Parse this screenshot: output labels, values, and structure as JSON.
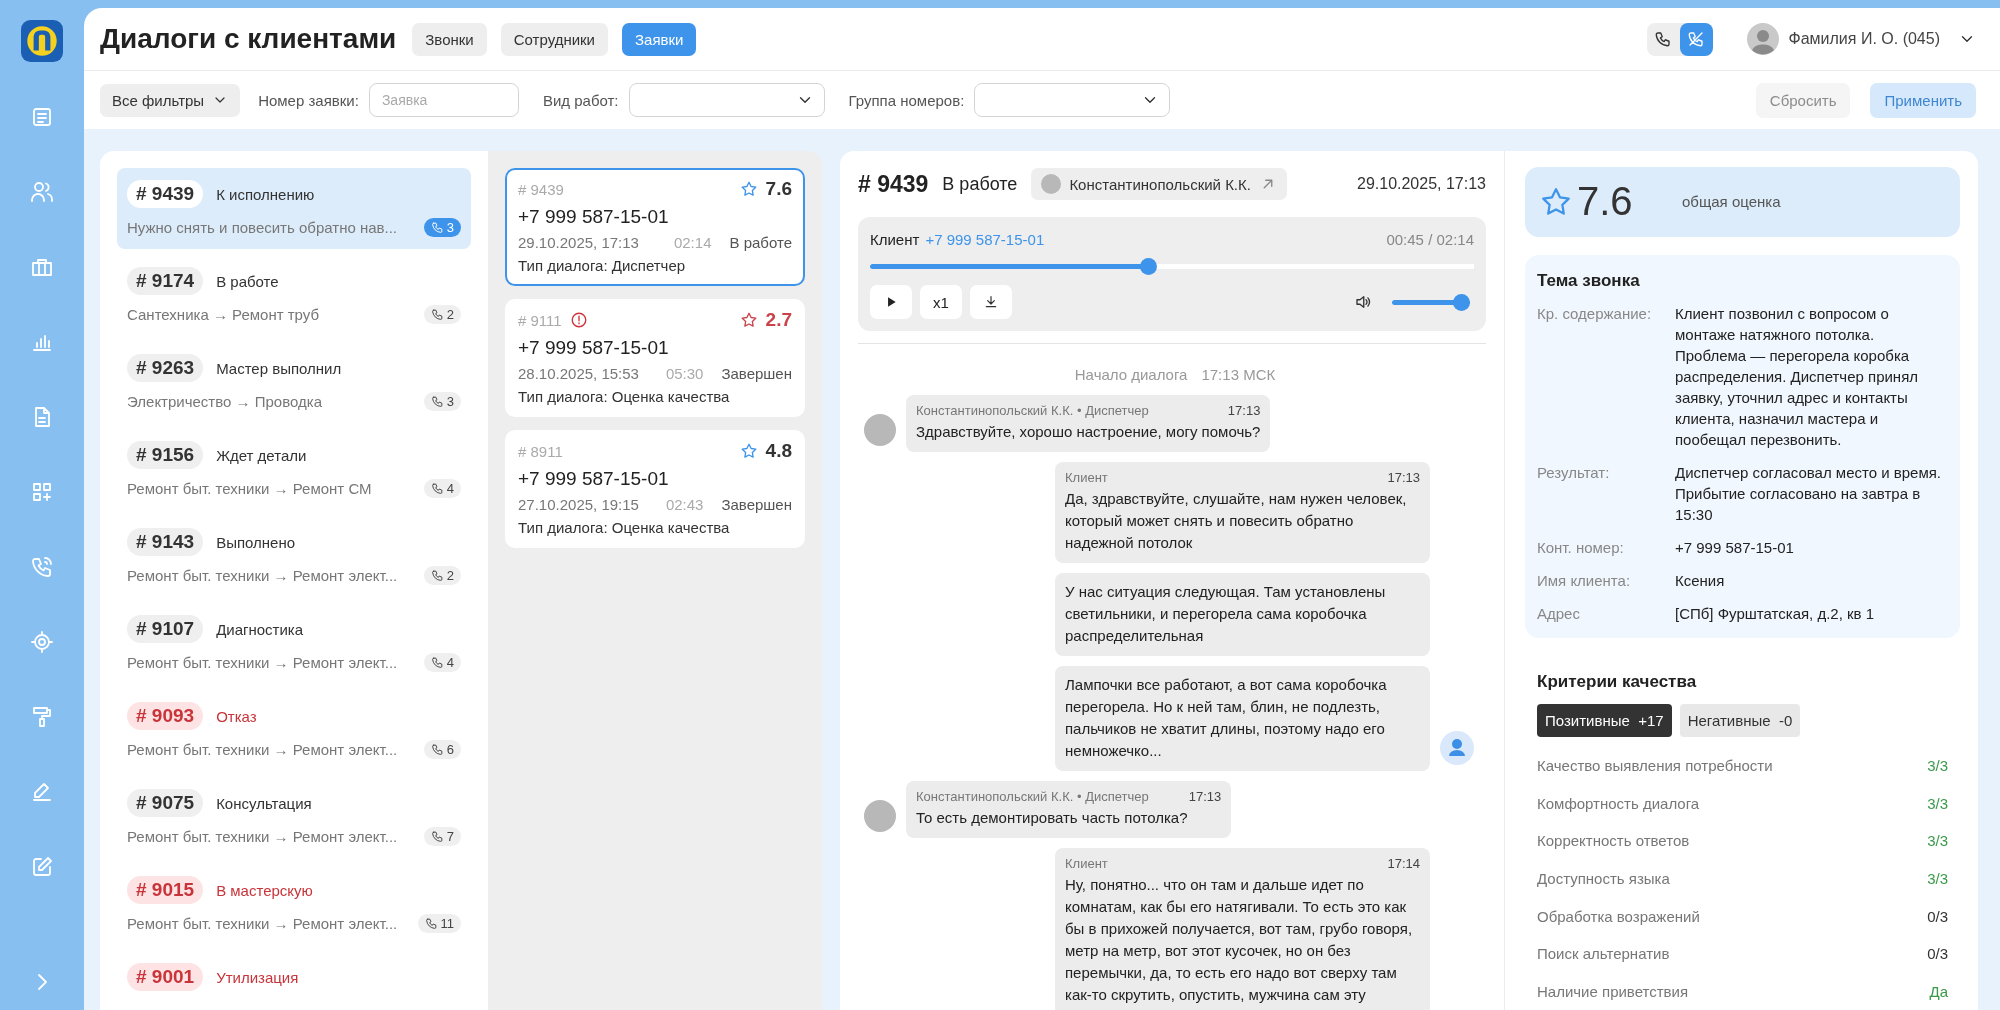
{
  "header": {
    "title": "Диалоги с клиентами",
    "tabs": [
      {
        "label": "Звонки",
        "selected": false
      },
      {
        "label": "Сотрудники",
        "selected": false
      },
      {
        "label": "Заявки",
        "selected": true
      }
    ],
    "call_modes": [
      {
        "kind": "phone",
        "selected": false
      },
      {
        "kind": "phone_off",
        "selected": true
      }
    ],
    "user": {
      "name": "Фамилия И. О. (045)"
    }
  },
  "filters": {
    "all_filters": "Все фильтры",
    "fields": [
      {
        "kind": "input",
        "label": "Номер заявки:",
        "placeholder": "Заявка"
      },
      {
        "kind": "select",
        "label": "Вид работ:"
      },
      {
        "kind": "select",
        "label": "Группа номеров:"
      }
    ],
    "buttons": [
      {
        "kind": "secondary",
        "label": "Сбросить",
        "disabled": true
      },
      {
        "kind": "primary",
        "label": "Применить",
        "disabled": true
      }
    ]
  },
  "orders": [
    {
      "number": "# 9439",
      "status": "К исполнению",
      "subtitle": "Нужно снять и повесить обратно нав...",
      "calls": "3",
      "alert": false,
      "selected": true
    },
    {
      "number": "# 9174",
      "status": "В работе",
      "subtitle": "Сантехника → Ремонт труб",
      "calls": "2",
      "alert": false,
      "selected": false
    },
    {
      "number": "# 9263",
      "status": "Мастер выполнил",
      "subtitle": "Электричество → Проводка",
      "calls": "3",
      "alert": false,
      "selected": false
    },
    {
      "number": "# 9156",
      "status": "Ждет детали",
      "subtitle": "Ремонт быт. техники → Ремонт СМ",
      "calls": "4",
      "alert": false,
      "selected": false
    },
    {
      "number": "# 9143",
      "status": "Выполнено",
      "subtitle": "Ремонт быт. техники → Ремонт элект...",
      "calls": "2",
      "alert": false,
      "selected": false
    },
    {
      "number": "# 9107",
      "status": "Диагностика",
      "subtitle": "Ремонт быт. техники → Ремонт элект...",
      "calls": "4",
      "alert": false,
      "selected": false
    },
    {
      "number": "# 9093",
      "status": "Отказ",
      "subtitle": "Ремонт быт. техники → Ремонт элект...",
      "calls": "6",
      "alert": true,
      "selected": false
    },
    {
      "number": "# 9075",
      "status": "Консультация",
      "subtitle": "Ремонт быт. техники → Ремонт элект...",
      "calls": "7",
      "alert": false,
      "selected": false
    },
    {
      "number": "# 9015",
      "status": "В мастерскую",
      "subtitle": "Ремонт быт. техники → Ремонт элект...",
      "calls": "11",
      "alert": true,
      "selected": false
    },
    {
      "number": "# 9001",
      "status": "Утилизация",
      "alert": true,
      "selected": false
    }
  ],
  "calls": [
    {
      "number": "# 9439",
      "flagged": false,
      "rating": "7.6",
      "low_rating": false,
      "phone": "+7 999 587-15-01",
      "date": "29.10.2025, 17:13",
      "duration": "02:14",
      "status": "В работе",
      "type": "Тип диалога: Диспетчер",
      "selected": true
    },
    {
      "number": "# 9111",
      "flagged": true,
      "rating": "2.7",
      "low_rating": true,
      "phone": "+7 999 587-15-01",
      "date": "28.10.2025, 15:53",
      "duration": "05:30",
      "status": "Завершен",
      "type": "Тип диалога: Оценка качества",
      "selected": false
    },
    {
      "number": "# 8911",
      "flagged": false,
      "rating": "4.8",
      "low_rating": false,
      "phone": "+7 999 587-15-01",
      "date": "27.10.2025, 19:15",
      "duration": "02:43",
      "status": "Завершен",
      "type": "Тип диалога: Оценка качества",
      "selected": false
    }
  ],
  "dialog": {
    "number": "# 9439",
    "status": "В работе",
    "operator": "Константинопольский К.К.",
    "date": "29.10.2025, 17:13",
    "player": {
      "label": "Клиент",
      "phone": "+7 999 587-15-01",
      "time": "00:45 / 02:14",
      "level": 0.46,
      "speed": "x1",
      "volume": {
        "level": 1
      }
    },
    "start": {
      "label": "Начало диалога",
      "time": "17:13 МСК"
    },
    "messages": [
      {
        "kind": "operator",
        "author": "Константинопольский К.К. • Диспетчер",
        "time": "17:13",
        "text": "Здравствуйте, хорошо настроение, могу помочь?",
        "show_avatar": true
      },
      {
        "kind": "client",
        "author": "Клиент",
        "time": "17:13",
        "text": "Да, здравствуйте, слушайте, нам нужен человек, который может снять и повесить обратно надежной потолок",
        "show_avatar": false
      },
      {
        "kind": "client",
        "text": "У нас ситуация следующая. Там установлены светильники, и перегорела сама коробочка распределительная",
        "show_avatar": false
      },
      {
        "kind": "client",
        "text": "Лампочки все работают, а вот сама коробочка перегорела. Но к ней там, блин, не подлезть, пальчиков не хватит длины, поэтому надо его немножечко...",
        "show_avatar": true
      },
      {
        "kind": "operator",
        "author": "Константинопольский К.К. • Диспетчер",
        "time": "17:13",
        "text": "То есть демонтировать часть потолка?",
        "show_avatar": true
      },
      {
        "kind": "client",
        "author": "Клиент",
        "time": "17:14",
        "text": "Ну, понятно... что он там и дальше идет по комнатам, как бы его натягивали. То есть это как бы в прихожей получается, вот там, грубо говоря, метр на метр, вот этот кусочек, но он без перемычки, да, то есть его надо вот сверху там как-то скрутить, опустить, мужчина сам эту",
        "show_avatar": false
      }
    ]
  },
  "summary": {
    "score": "7.6",
    "score_label": "общая оценка",
    "topic": {
      "title": "Тема звонка",
      "rows": [
        {
          "label": "Кр. содержание:",
          "value": "Клиент позвонил с вопросом о монтаже натяжного потолка. Проблема — перегорела коробка распределения. Диспетчер принял заявку, уточнил адрес и контакты клиента, назначил мастера и пообещал перезвонить."
        },
        {
          "label": "Результат:",
          "value": "Диспетчер согласовал место и время. Прибытие согласовано на завтра в 15:30"
        },
        {
          "label": "Конт. номер:",
          "value": "+7 999 587-15-01"
        },
        {
          "label": "Имя клиента:",
          "value": "Ксения"
        },
        {
          "label": "Адрес",
          "value": "[СПб] Фурштатская, д.2, кв 1"
        }
      ]
    },
    "criteria": {
      "title": "Критерии качества",
      "tabs": [
        {
          "label": "Позитивные",
          "count": "+17",
          "selected": true
        },
        {
          "label": "Негативные",
          "count": "-0",
          "selected": false
        }
      ],
      "items": [
        {
          "name": "Качество выявления потребности",
          "value": "3/3",
          "passed": true
        },
        {
          "name": "Комфортность диалога",
          "value": "3/3",
          "passed": true
        },
        {
          "name": "Корректность ответов",
          "value": "3/3",
          "passed": true
        },
        {
          "name": "Доступность языка",
          "value": "3/3",
          "passed": true
        },
        {
          "name": "Обработка возражений",
          "value": "0/3",
          "passed": false
        },
        {
          "name": "Поиск альтернатив",
          "value": "0/3",
          "passed": false
        },
        {
          "name": "Наличие приветствия",
          "value": "Да",
          "passed": true
        }
      ]
    }
  }
}
